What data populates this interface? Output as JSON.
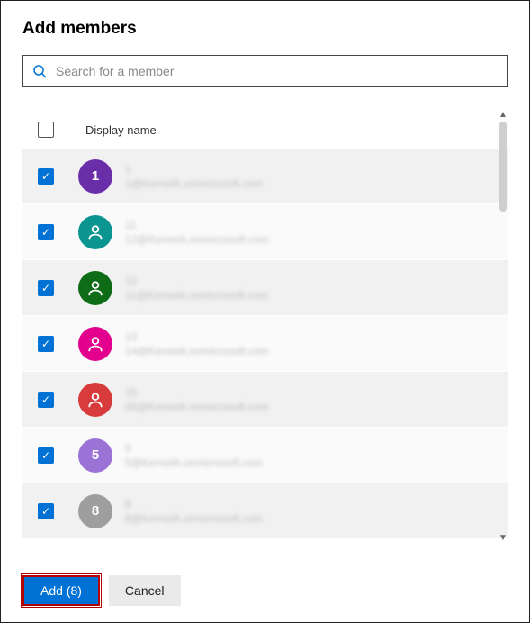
{
  "title": "Add members",
  "search": {
    "placeholder": "Search for a member"
  },
  "columns": {
    "display_name": "Display name"
  },
  "header_checked": false,
  "rows": [
    {
      "avatar_bg": "#6a2fa8",
      "avatar_text": "1",
      "avatar_icon": false,
      "name": "1",
      "email": "1@KernelA.onmicrosoft.com",
      "checked": true,
      "alt": false
    },
    {
      "avatar_bg": "#0b9591",
      "avatar_text": "",
      "avatar_icon": true,
      "name": "11",
      "email": "12@KernelA.onmicrosoft.com",
      "checked": true,
      "alt": true
    },
    {
      "avatar_bg": "#0e6b16",
      "avatar_text": "",
      "avatar_icon": true,
      "name": "12",
      "email": "11@KernelA.onmicrosoft.com",
      "checked": true,
      "alt": false
    },
    {
      "avatar_bg": "#e3008c",
      "avatar_text": "",
      "avatar_icon": true,
      "name": "13",
      "email": "14@KernelA.onmicrosoft.com",
      "checked": true,
      "alt": true
    },
    {
      "avatar_bg": "#d83b3b",
      "avatar_text": "",
      "avatar_icon": true,
      "name": "15",
      "email": "09@KernelA.onmicrosoft.com",
      "checked": true,
      "alt": false
    },
    {
      "avatar_bg": "#9b72d6",
      "avatar_text": "5",
      "avatar_icon": false,
      "name": "5",
      "email": "5@KernelA.onmicrosoft.com",
      "checked": true,
      "alt": true
    },
    {
      "avatar_bg": "#9e9e9e",
      "avatar_text": "8",
      "avatar_icon": false,
      "name": "8",
      "email": "8@KernelA.onmicrosoft.com",
      "checked": true,
      "alt": false
    }
  ],
  "buttons": {
    "add": "Add (8)",
    "cancel": "Cancel"
  }
}
